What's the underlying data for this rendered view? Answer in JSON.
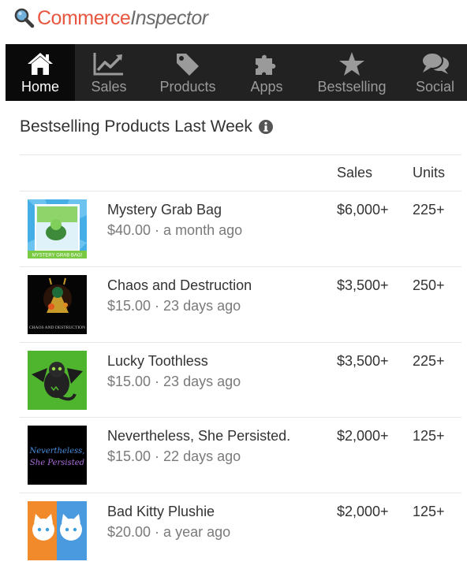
{
  "brand": {
    "name_part1": "Commerce",
    "name_part2": "Inspector"
  },
  "nav": {
    "items": [
      {
        "label": "Home",
        "icon": "home-icon",
        "active": true
      },
      {
        "label": "Sales",
        "icon": "chart-icon"
      },
      {
        "label": "Products",
        "icon": "tag-icon"
      },
      {
        "label": "Apps",
        "icon": "puzzle-icon"
      },
      {
        "label": "Bestselling",
        "icon": "star-icon"
      },
      {
        "label": "Social",
        "icon": "chat-icon"
      }
    ]
  },
  "section": {
    "title": "Bestselling Products Last Week"
  },
  "table": {
    "headers": {
      "sales": "Sales",
      "units": "Units"
    },
    "rows": [
      {
        "name": "Mystery Grab Bag",
        "meta": "$40.00 · a month ago",
        "sales": "$6,000+",
        "units": "225+",
        "thumb_caption": "MYSTERY GRAB BAG!"
      },
      {
        "name": "Chaos and Destruction",
        "meta": "$15.00 · 23 days ago",
        "sales": "$3,500+",
        "units": "250+",
        "thumb_caption": "CHAOS AND DESTRUCTION"
      },
      {
        "name": "Lucky Toothless",
        "meta": "$15.00 · 23 days ago",
        "sales": "$3,500+",
        "units": "225+"
      },
      {
        "name": "Nevertheless, She Persisted.",
        "meta": "$15.00 · 22 days ago",
        "sales": "$2,000+",
        "units": "125+",
        "thumb_line1": "Nevertheless,",
        "thumb_line2": "She Persisted"
      },
      {
        "name": "Bad Kitty Plushie",
        "meta": "$20.00 · a year ago",
        "sales": "$2,000+",
        "units": "125+"
      }
    ]
  },
  "colors": {
    "brand_orange": "#e8563f",
    "brand_gray": "#6b6b6b",
    "nav_bg": "#222222",
    "nav_active_bg": "#0a0a0a",
    "nav_text": "#9a9a9a"
  }
}
